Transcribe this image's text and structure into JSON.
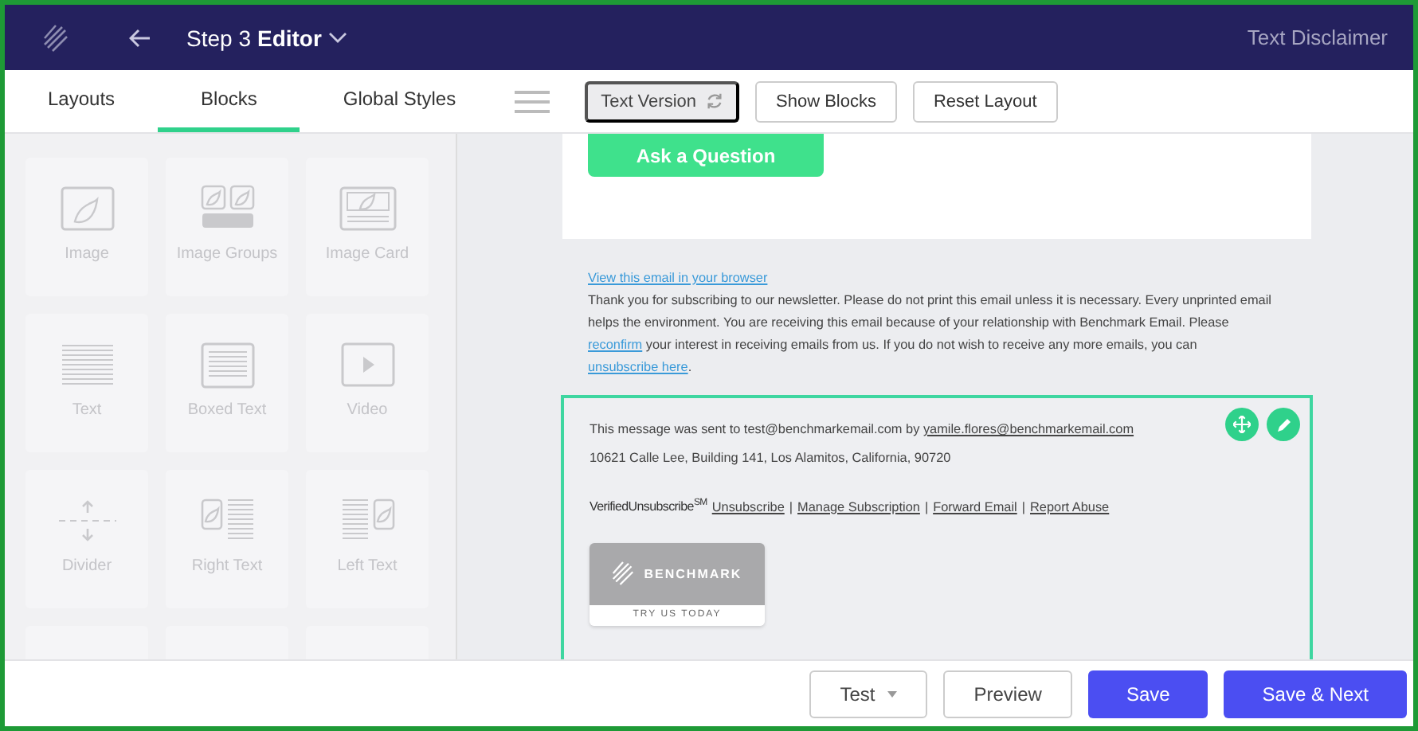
{
  "header": {
    "step": "Step 3",
    "title": "Editor",
    "page_name": "Text Disclaimer"
  },
  "tabs": [
    {
      "label": "Layouts",
      "selected": false
    },
    {
      "label": "Blocks",
      "selected": true
    },
    {
      "label": "Global Styles",
      "selected": false
    }
  ],
  "toolbar": {
    "text_version": "Text Version",
    "buttons": [
      "Show Blocks",
      "Reset Layout"
    ]
  },
  "blocks": [
    {
      "label": "Image",
      "kind": "image"
    },
    {
      "label": "Image Groups",
      "kind": "image-groups"
    },
    {
      "label": "Image Card",
      "kind": "image-card"
    },
    {
      "label": "Text",
      "kind": "text"
    },
    {
      "label": "Boxed Text",
      "kind": "boxed-text"
    },
    {
      "label": "Video",
      "kind": "video"
    },
    {
      "label": "Divider",
      "kind": "divider"
    },
    {
      "label": "Right Text",
      "kind": "right-text"
    },
    {
      "label": "Left Text",
      "kind": "left-text"
    }
  ],
  "email": {
    "cta": "Ask a Question",
    "view_link": "View this email in your browser",
    "notice": [
      {
        "kind": "text",
        "text": "Thank you for subscribing to our newsletter. Please do not print this email unless it is necessary. Every unprinted email helps the environment. You are receiving this email because of your relationship with Benchmark Email. Please "
      },
      {
        "kind": "link",
        "text": "reconfirm"
      },
      {
        "kind": "text",
        "text": " your interest in receiving emails from us. If you do not wish to receive any more emails, you can "
      },
      {
        "kind": "link",
        "text": "unsubscribe here"
      },
      {
        "kind": "text",
        "text": "."
      }
    ],
    "footer": {
      "selected": true,
      "sent_line": [
        {
          "kind": "text",
          "text": "This message was sent to test@benchmarkemail.com by "
        },
        {
          "kind": "link",
          "text": "yamile.flores@benchmarkemail.com"
        }
      ],
      "address": "10621 Calle Lee, Building 141, Los Alamitos, California, 90720",
      "verified": "VerifiedUnsubscribe$^{SM}$",
      "links": [
        {
          "kind": "link",
          "text": "Unsubscribe"
        },
        {
          "kind": "sep",
          "text": "|"
        },
        {
          "kind": "link",
          "text": "Manage Subscription"
        },
        {
          "kind": "sep",
          "text": "|"
        },
        {
          "kind": "link",
          "text": "Forward Email"
        },
        {
          "kind": "sep",
          "text": "|"
        },
        {
          "kind": "link",
          "text": "Report Abuse"
        }
      ],
      "badge_brand": "BENCHMARK",
      "badge_caption": "TRY US TODAY"
    }
  },
  "bottom_buttons": [
    {
      "label": "Test",
      "kind": "dropdown"
    },
    {
      "label": "Preview",
      "kind": "outline"
    },
    {
      "label": "Save",
      "kind": "primary"
    },
    {
      "label": "Save & Next",
      "kind": "primary"
    }
  ]
}
